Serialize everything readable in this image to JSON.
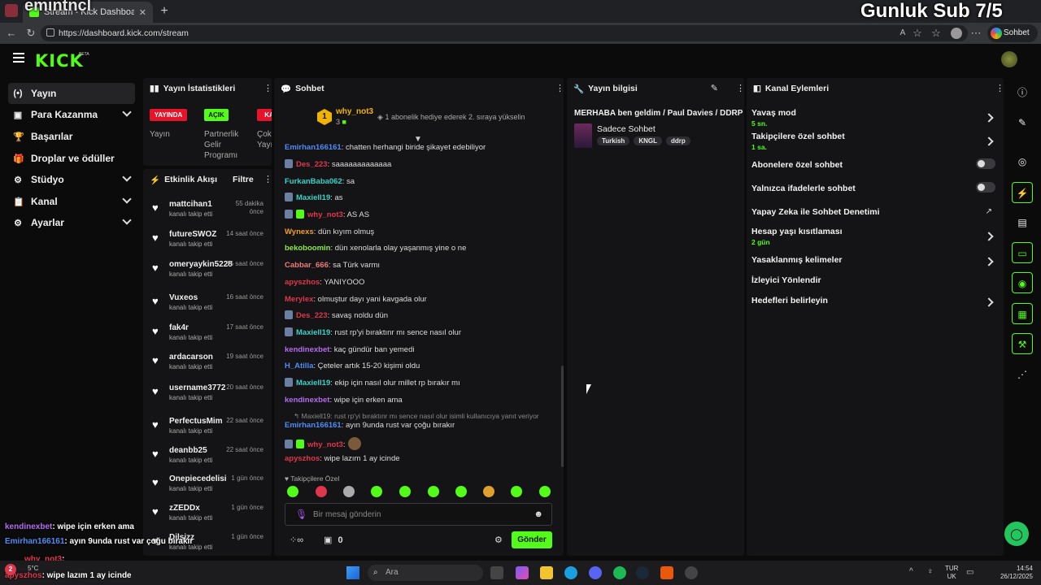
{
  "browser": {
    "tab_title": "Stream - Kick Dashboard",
    "url": "https://dashboard.kick.com/stream",
    "copilot_label": "Sohbet et"
  },
  "overlay": {
    "streamer": "emintncl",
    "sub_goal": "Gunluk Sub 7/5",
    "chat": [
      {
        "user": "kendinexbet",
        "text": ": wipe için erken ama",
        "color": "#b46cf0"
      },
      {
        "user": "Emirhan166161",
        "text": ": ayın 9unda rust var çoğu bırakır",
        "color": "#4f8df5"
      },
      {
        "user": "why_not3",
        "text": ":",
        "color": "#e0364b"
      },
      {
        "user": "apyszhos",
        "text": ": wipe lazım 1 ay icinde",
        "color": "#e0364b"
      }
    ]
  },
  "app": {
    "logo": "KICK",
    "logo_badge": "BETA"
  },
  "nav": {
    "items": [
      {
        "label": "Yayın",
        "icon": "(•)"
      },
      {
        "label": "Para Kazanma",
        "icon": "▣"
      },
      {
        "label": "Başarılar",
        "icon": "🏆"
      },
      {
        "label": "Droplar ve ödüller",
        "icon": "🎁"
      },
      {
        "label": "Stüdyo",
        "icon": "⚙"
      },
      {
        "label": "Kanal",
        "icon": "📋"
      },
      {
        "label": "Ayarlar",
        "icon": "⚙"
      }
    ]
  },
  "stats": {
    "title": "Yayın İstatistikleri",
    "pills": [
      "YAYINDA",
      "AÇIK",
      "KA"
    ],
    "labels": [
      "Yayın",
      "Partnerlik Gelir Programı",
      "Çok Yayı"
    ]
  },
  "activity": {
    "title": "Etkinlik Akışı",
    "filter": "Filtre",
    "sub": "kanalı takip etti",
    "items": [
      {
        "name": "mattcihan1",
        "time": "55 dakika önce"
      },
      {
        "name": "futureSWOZ",
        "time": "14 saat önce"
      },
      {
        "name": "omeryaykin5228",
        "time": "15 saat önce"
      },
      {
        "name": "Vuxeos",
        "time": "16 saat önce"
      },
      {
        "name": "fak4r",
        "time": "17 saat önce"
      },
      {
        "name": "ardacarson",
        "time": "19 saat önce"
      },
      {
        "name": "username3772",
        "time": "20 saat önce"
      },
      {
        "name": "PerfectusMim",
        "time": "22 saat önce"
      },
      {
        "name": "deanbb25",
        "time": "22 saat önce"
      },
      {
        "name": "Onepiecedelisi",
        "time": "1 gün önce"
      },
      {
        "name": "zZEDDx",
        "time": "1 gün önce"
      },
      {
        "name": "Dilsizz",
        "time": "1 gün önce"
      }
    ]
  },
  "chat": {
    "title": "Sohbet",
    "pinned_user": "why_not3",
    "pinned_count": "3",
    "pinned_rank": "1",
    "pinned_text": "1 abonelik hediye ederek 2. sıraya yükselin",
    "messages": [
      {
        "user": "Emirhan166161",
        "color": "#4f8df5",
        "text": ": chatten herhangi biride şikayet edebiliyor"
      },
      {
        "user": "Des_223",
        "color": "#e0364b",
        "text": ": saaaaaaaaaaaaa"
      },
      {
        "user": "FurkanBaba062",
        "color": "#39d1c9",
        "text": ": sa"
      },
      {
        "user": "Maxiell19",
        "color": "#39d1c9",
        "text": ": as"
      },
      {
        "user": "why_not3",
        "color": "#e0364b",
        "text": ": AS AS"
      },
      {
        "user": "Wynexs",
        "color": "#f0a020",
        "text": ": dün kıyım olmuş"
      },
      {
        "user": "bekoboomin",
        "color": "#8ee84a",
        "text": ": dün xenolarla olay yaşanmış yine o ne"
      },
      {
        "user": "Cabbar_666",
        "color": "#f07a7a",
        "text": ": sa Türk varmı"
      },
      {
        "user": "apyszhos",
        "color": "#e0364b",
        "text": ": YANIYOOO"
      },
      {
        "user": "Merylex",
        "color": "#e0364b",
        "text": ": olmuştur dayı yani kavgada olur"
      },
      {
        "user": "Des_223",
        "color": "#e0364b",
        "text": ": savaş noldu dün"
      },
      {
        "user": "Maxiell19",
        "color": "#39d1c9",
        "text": ": rust rp'yi bıraktınr mı sence nasıl olur"
      },
      {
        "user": "kendinexbet",
        "color": "#b46cf0",
        "text": ": kaç gündür ban yemedi"
      },
      {
        "user": "H_Atilla",
        "color": "#4f8df5",
        "text": ": Çeteler artık 15-20 kişimi oldu"
      },
      {
        "user": "Maxiell19",
        "color": "#39d1c9",
        "text": ": ekip için nasıl olur millet rp bırakır mı"
      },
      {
        "user": "kendinexbet",
        "color": "#b46cf0",
        "text": ": wipe için erken ama"
      },
      {
        "user": "Emirhan166161",
        "color": "#4f8df5",
        "text": ": ayın 9unda rust var çoğu bırakır"
      },
      {
        "user": "why_not3",
        "color": "#e0364b",
        "text": ":"
      },
      {
        "user": "apyszhos",
        "color": "#e0364b",
        "text": ": wipe lazım 1 ay icinde"
      }
    ],
    "reply_ref": "Maxiell19: rust rp'yi bıraktınr mı sence nasıl olur isimli kullanıcıya yanıt veriyor",
    "followers_only": "Takipçilere Özel",
    "placeholder": "Bir mesaj gönderin",
    "gift_count": "0",
    "send_label": "Gönder"
  },
  "info": {
    "title": "Yayın bilgisi",
    "stream_title": "MERHABA ben geldim / Paul Davies / DDRP",
    "category": "Sadece Sohbet",
    "tags": [
      "Turkish",
      "KNGL",
      "ddrp"
    ]
  },
  "actions": {
    "title": "Kanal Eylemleri",
    "items": [
      {
        "label": "Yavaş mod",
        "value": "5 sn.",
        "kind": "chevron"
      },
      {
        "label": "Takipçilere özel sohbet",
        "value": "1 sa.",
        "kind": "chevron"
      },
      {
        "label": "Abonelere özel sohbet",
        "value": "",
        "kind": "toggle"
      },
      {
        "label": "Yalnızca ifadelerle sohbet",
        "value": "",
        "kind": "toggle"
      },
      {
        "label": "Yapay Zeka ile Sohbet Denetimi",
        "value": "",
        "kind": "external"
      },
      {
        "label": "Hesap yaşı kısıtlaması",
        "value": "2 gün",
        "kind": "chevron"
      },
      {
        "label": "Yasaklanmış kelimeler",
        "value": "",
        "kind": "chevron"
      },
      {
        "label": "İzleyici Yönlendir",
        "value": "",
        "kind": "none"
      },
      {
        "label": "Hedefleri belirleyin",
        "value": "",
        "kind": "chevron"
      }
    ]
  },
  "taskbar": {
    "search": "Ara",
    "lang_top": "TUR",
    "lang_bottom": "UK",
    "time": "14:54",
    "date": "26/12/2025",
    "temp": "5°C",
    "weather_badge": "2"
  },
  "colors": {
    "accent": "#53fc18",
    "live": "#e5142a"
  }
}
